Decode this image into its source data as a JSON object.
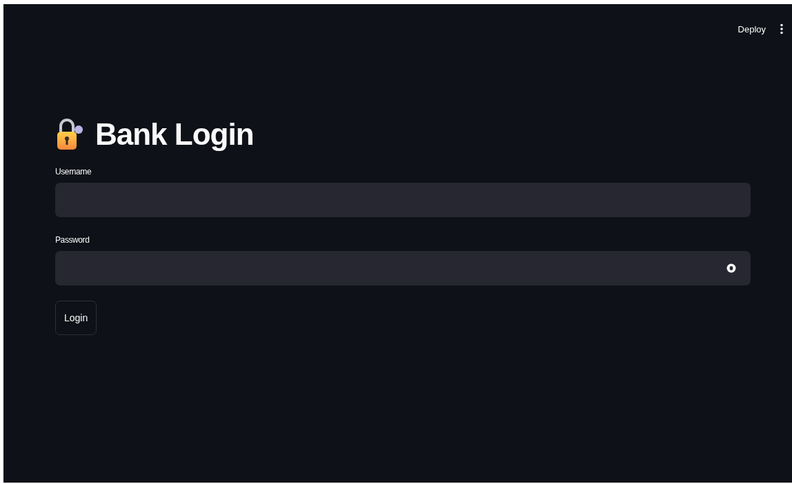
{
  "header": {
    "deploy_label": "Deploy"
  },
  "title": "Bank Login",
  "fields": [
    {
      "label": "Username",
      "kind": "text"
    },
    {
      "label": "Password",
      "kind": "password"
    }
  ],
  "button": {
    "label": "Login"
  }
}
